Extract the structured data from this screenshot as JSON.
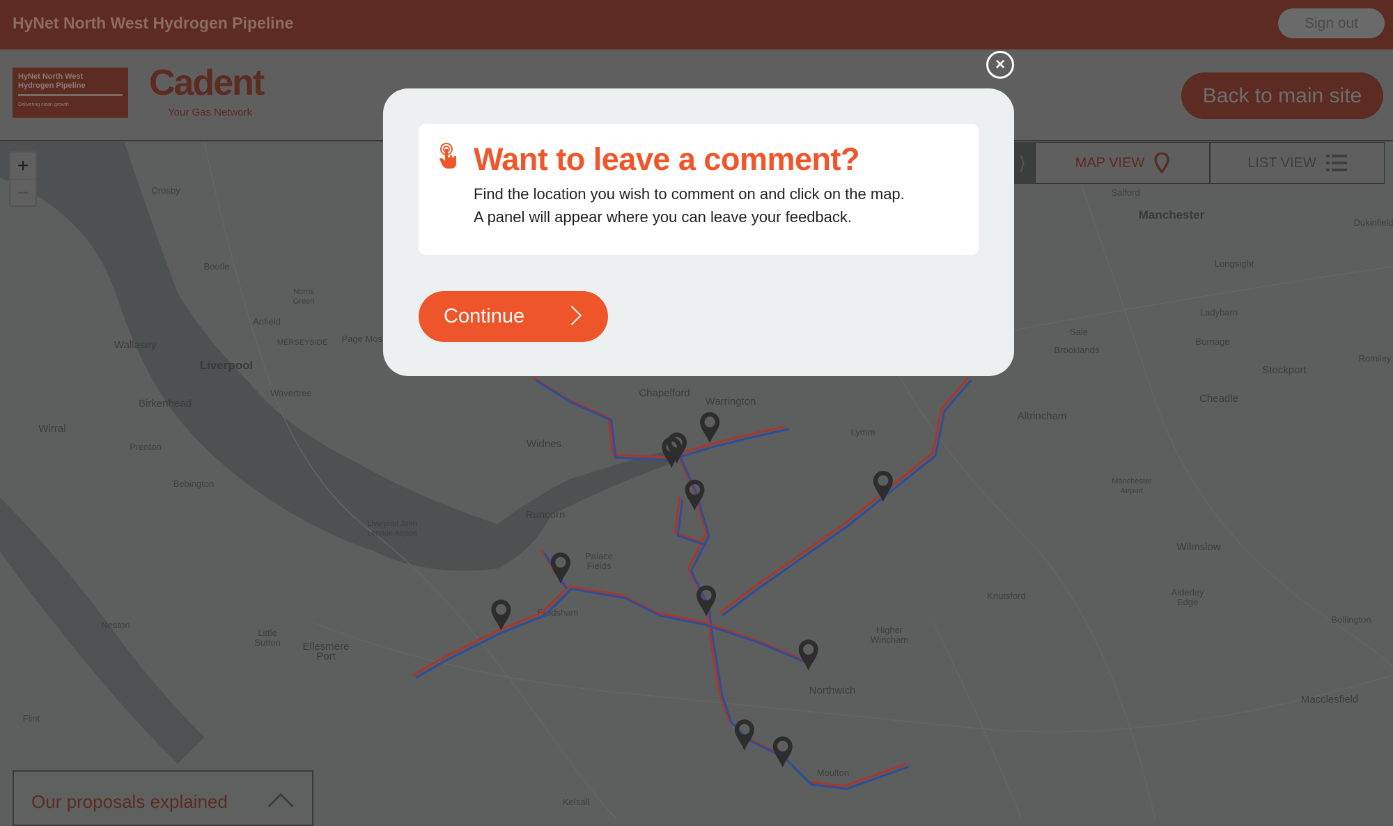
{
  "topbar": {
    "title": "HyNet North West Hydrogen Pipeline",
    "sign_out": "Sign out"
  },
  "header": {
    "logo_line1": "HyNet North West",
    "logo_line2": "Hydrogen Pipeline",
    "logo_tagline": "Delivering clean growth",
    "brand": "Cadent",
    "brand_sub": "Your Gas Network",
    "back_button": "Back to main site"
  },
  "tabs": [
    {
      "label": "MAP VIEW",
      "icon": "map-pin-icon",
      "active": true
    },
    {
      "label": "LIST VIEW",
      "icon": "list-icon",
      "active": false
    }
  ],
  "zoom": {
    "in": "+",
    "out": "−"
  },
  "map": {
    "labels": [
      "Crosby",
      "Bootle",
      "Norris Green",
      "Anfield",
      "MERSEYSIDE",
      "Page Moss",
      "Wallasey",
      "Liverpool",
      "Wavertree",
      "Birkenhead",
      "Wirral",
      "Prenton",
      "Bebington",
      "Widnes",
      "Chapelford",
      "Warrington",
      "Lymm",
      "Runcorn",
      "Liverpool John Lennon Airport",
      "Palace Fields",
      "Frodsham",
      "Neston",
      "Little Sutton",
      "Ellesmere Port",
      "Flint",
      "Kelsall",
      "Northwich",
      "Higher Wincham",
      "Moulton",
      "Knutsford",
      "Altrincham",
      "Sale",
      "Brooklands",
      "Salford",
      "Manchester",
      "Longsight",
      "Ladybarn",
      "Burnage",
      "Stockport",
      "Cheadle",
      "Manchester Airport",
      "Wilmslow",
      "Alderley Edge",
      "Bollington",
      "Macclesfield",
      "Romiley",
      "Dukinfield"
    ],
    "pipeline_colors": {
      "proposed": "#a8382a",
      "existing": "#2e4f98"
    }
  },
  "proposals": {
    "label": "Our proposals explained"
  },
  "modal": {
    "title": "Want to leave a comment?",
    "line1": "Find the location you wish to comment on and click on the map.",
    "line2": "A panel will appear where you can leave your feedback.",
    "continue": "Continue",
    "close": "×",
    "accent": "#ef552b"
  }
}
